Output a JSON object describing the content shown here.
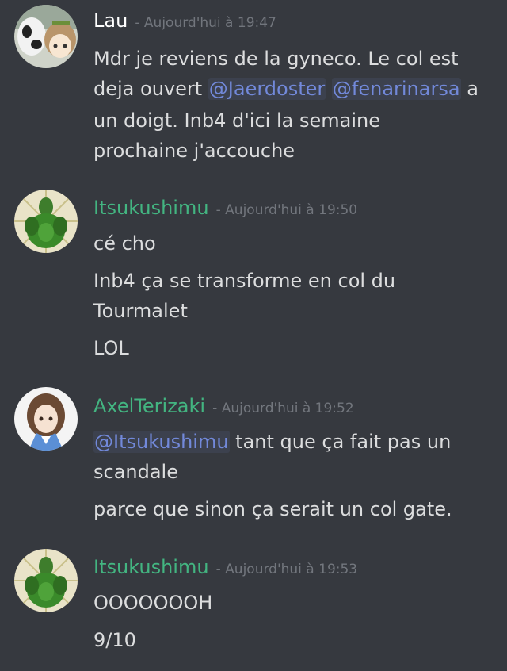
{
  "colors": {
    "background": "#36393f",
    "text": "#dcddde",
    "timestamp": "#72767d",
    "mention": "#7289da",
    "user_lau": "#ffffff",
    "user_green": "#43b581"
  },
  "messages": [
    {
      "author": "Lau",
      "timestamp": "- Aujourd'hui à 19:47",
      "avatar_icon": "anime-girl-cow-avatar-icon",
      "lines": [
        {
          "before": "Mdr je reviens de la gyneco. Le col est",
          "mention": "",
          "after": ""
        },
        {
          "before": "deja ouvert ",
          "mention": "@Jaerdoster",
          "mention2": "@fenarinarsa",
          "after": " a"
        },
        {
          "before": "un doigt. Inb4 d'ici la semaine",
          "mention": "",
          "after": ""
        },
        {
          "before": "prochaine j'accouche",
          "mention": "",
          "after": ""
        }
      ]
    },
    {
      "author": "Itsukushimu",
      "timestamp": "- Aujourd'hui à 19:50",
      "avatar_icon": "green-muscle-cactus-avatar-icon",
      "lines": [
        "cé cho",
        "Inb4 ça se transforme en col du",
        "Tourmalet",
        "LOL"
      ]
    },
    {
      "author": "AxelTerizaki",
      "timestamp": "- Aujourd'hui à 19:52",
      "avatar_icon": "anime-girl-kimono-avatar-icon",
      "lines": [
        {
          "before": "",
          "mention": "@Itsukushimu",
          "after": " tant que ça fait pas un"
        },
        "scandale",
        "parce que sinon ça serait un col gate."
      ]
    },
    {
      "author": "Itsukushimu",
      "timestamp": "- Aujourd'hui à 19:53",
      "avatar_icon": "green-muscle-cactus-avatar-icon",
      "lines": [
        "OOOOOOOH",
        "9/10"
      ]
    }
  ]
}
